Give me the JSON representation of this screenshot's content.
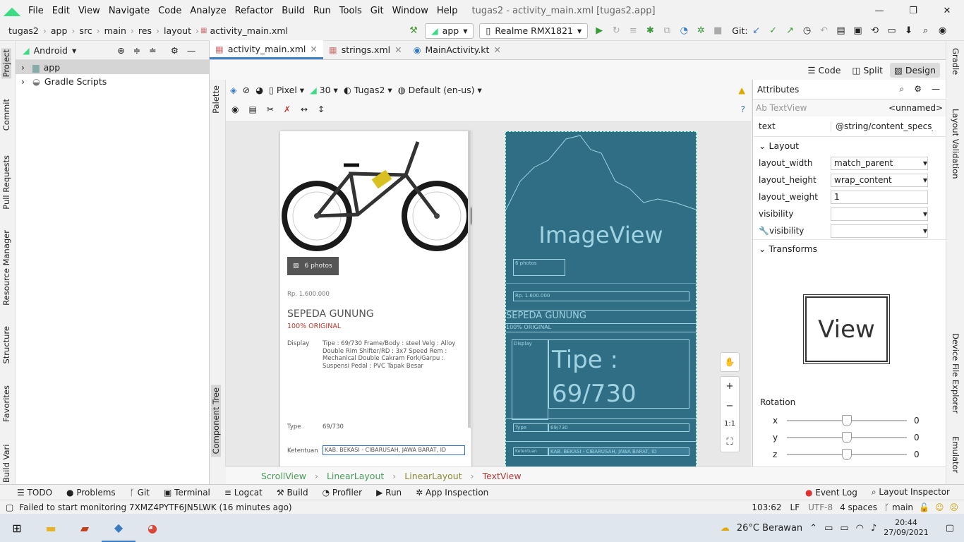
{
  "window": {
    "title": "tugas2 - activity_main.xml [tugas2.app]",
    "menus": [
      "File",
      "Edit",
      "View",
      "Navigate",
      "Code",
      "Analyze",
      "Refactor",
      "Build",
      "Run",
      "Tools",
      "Git",
      "Window",
      "Help"
    ],
    "minimize": "—",
    "maximize": "❐",
    "close": "✕"
  },
  "nav": {
    "crumbs": [
      "tugas2",
      "app",
      "src",
      "main",
      "res",
      "layout",
      "activity_main.xml"
    ],
    "module": "app",
    "device": "Realme RMX1821",
    "git_label": "Git:"
  },
  "left_tabs": [
    "Project",
    "Commit",
    "Pull Requests",
    "Resource Manager",
    "Structure",
    "Favorites",
    "Build Variants"
  ],
  "project": {
    "view": "Android",
    "items": [
      "app",
      "Gradle Scripts"
    ]
  },
  "editor_tabs": [
    {
      "label": "activity_main.xml"
    },
    {
      "label": "strings.xml"
    },
    {
      "label": "MainActivity.kt"
    }
  ],
  "modes": {
    "code": "Code",
    "split": "Split",
    "design": "Design"
  },
  "design_toolbar": {
    "device": "Pixel",
    "api": "30",
    "theme": "Tugas2",
    "locale": "Default (en-us)"
  },
  "palette_label": "Palette",
  "component_tree_label": "Component Tree",
  "preview": {
    "photos": "6 photos",
    "price": "Rp. 1.600.000",
    "title": "SEPEDA GUNUNG",
    "original": "100% ORIGINAL",
    "display_label": "Display",
    "display_text": "Tipe : 69/730 Frame/Body : steel Velg : Alloy Double Rim Shifter/RD : 3x7 Speed Rem : Mechanical Double Cakram Fork/Garpu : Suspensi Pedal : PVC Tapak Besar",
    "type_label": "Type",
    "type_value": "69/730",
    "ketentuan_label": "Ketentuan",
    "ketentuan_value": "KAB. BEKASI - CIBARUSAH, JAWA BARAT, ID"
  },
  "blueprint": {
    "imageview": "ImageView",
    "photos": "6 photos",
    "price": "Rp. 1.600.000",
    "title": "SEPEDA GUNUNG",
    "original": "100% ORIGINAL",
    "display": "Display",
    "tipe_big": "Tipe : 69/730",
    "type": "Type",
    "type_value": "69/730",
    "ketentuan": "Ketentuan",
    "ketentuan_value": "KAB. BEKASI - CIBARUSAH, JAWA BARAT, ID"
  },
  "zoom": {
    "ratio": "1:1",
    "plus": "+",
    "minus": "−"
  },
  "attributes": {
    "header": "Attributes",
    "component": "TextView",
    "id": "<unnamed>",
    "text_name": "text",
    "text_value": "@string/content_specs_k",
    "layout_section": "Layout",
    "rows": [
      {
        "name": "layout_width",
        "value": "match_parent"
      },
      {
        "name": "layout_height",
        "value": "wrap_content"
      },
      {
        "name": "layout_weight",
        "value": "1"
      },
      {
        "name": "visibility",
        "value": ""
      },
      {
        "name": "visibility",
        "value": ""
      }
    ],
    "transforms": "Transforms",
    "view_label": "View",
    "rotation": "Rotation",
    "axes": [
      {
        "axis": "x",
        "value": "0"
      },
      {
        "axis": "y",
        "value": "0"
      },
      {
        "axis": "z",
        "value": "0"
      }
    ]
  },
  "right_tabs": [
    "Gradle",
    "Layout Validation",
    "Device File Explorer",
    "Emulator"
  ],
  "breadcrumb": [
    "ScrollView",
    "LinearLayout",
    "LinearLayout",
    "TextView"
  ],
  "bottom_tools": [
    "TODO",
    "Problems",
    "Git",
    "Terminal",
    "Logcat",
    "Build",
    "Profiler",
    "Run",
    "App Inspection"
  ],
  "bottom_right": [
    "Event Log",
    "Layout Inspector"
  ],
  "status": {
    "message": "Failed to start monitoring 7XMZ4PYTF6JN5LWK (16 minutes ago)",
    "position": "103:62",
    "lf": "LF",
    "encoding": "UTF-8",
    "indent": "4 spaces",
    "branch": "main"
  },
  "taskbar": {
    "weather": "26°C  Berawan",
    "time": "20:44",
    "date": "27/09/2021"
  }
}
